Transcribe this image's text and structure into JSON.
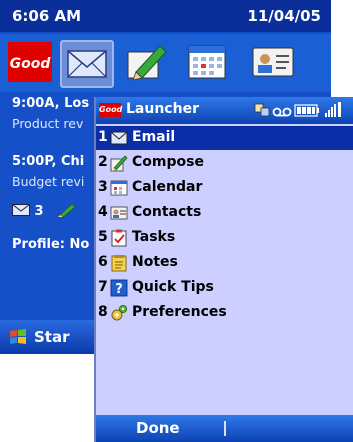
{
  "today": {
    "time": "6:06 AM",
    "date": "11/04/05",
    "logo_text": "Good",
    "agenda": [
      {
        "title": "9:00A, Los",
        "subtitle": "Product rev"
      },
      {
        "title": "5:00P, Chi",
        "subtitle": "Budget revi"
      }
    ],
    "mail_count": "3",
    "profile": "Profile: No",
    "start_label": "Star"
  },
  "launcher": {
    "logo_text": "Good",
    "title": "Launcher",
    "items": [
      {
        "num": "1",
        "label": "Email",
        "icon": "email-icon"
      },
      {
        "num": "2",
        "label": "Compose",
        "icon": "compose-icon"
      },
      {
        "num": "3",
        "label": "Calendar",
        "icon": "calendar-icon"
      },
      {
        "num": "4",
        "label": "Contacts",
        "icon": "contacts-icon"
      },
      {
        "num": "5",
        "label": "Tasks",
        "icon": "tasks-icon"
      },
      {
        "num": "6",
        "label": "Notes",
        "icon": "notes-icon"
      },
      {
        "num": "7",
        "label": "Quick Tips",
        "icon": "quick-tips-icon"
      },
      {
        "num": "8",
        "label": "Preferences",
        "icon": "preferences-icon"
      }
    ],
    "selected_index": 0,
    "done_label": "Done"
  },
  "colors": {
    "titlebar": "#0d43b3",
    "selection": "#0b2ea8",
    "menu_background": "#cccfff",
    "today_background": "#1650c8",
    "brand_red": "#e10000"
  }
}
